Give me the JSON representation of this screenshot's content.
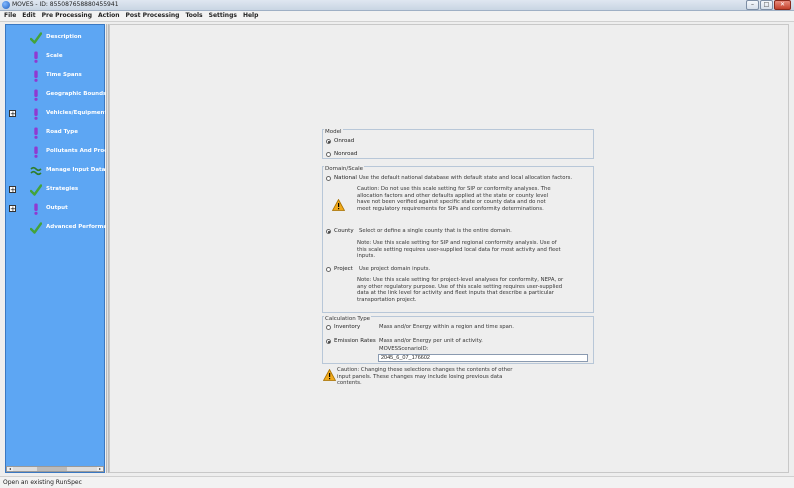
{
  "window": {
    "title": "MOVES - ID: 855087658880455941"
  },
  "menu": [
    "File",
    "Edit",
    "Pre Processing",
    "Action",
    "Post Processing",
    "Tools",
    "Settings",
    "Help"
  ],
  "sidebar": {
    "items": [
      {
        "label": "Description",
        "icon": "check-icon",
        "expander": ""
      },
      {
        "label": "Scale",
        "icon": "exclamation-icon",
        "expander": ""
      },
      {
        "label": "Time Spans",
        "icon": "exclamation-icon",
        "expander": ""
      },
      {
        "label": "Geographic Bounds",
        "icon": "exclamation-icon",
        "expander": ""
      },
      {
        "label": "Vehicles/Equipment",
        "icon": "exclamation-icon",
        "expander": "+"
      },
      {
        "label": "Road Type",
        "icon": "exclamation-icon",
        "expander": ""
      },
      {
        "label": "Pollutants And Processes",
        "icon": "exclamation-icon",
        "expander": ""
      },
      {
        "label": "Manage Input Data Sets",
        "icon": "wave-icon",
        "expander": ""
      },
      {
        "label": "Strategies",
        "icon": "check-icon",
        "expander": "+"
      },
      {
        "label": "Output",
        "icon": "exclamation-icon",
        "expander": "+"
      },
      {
        "label": "Advanced Performance Features",
        "icon": "check-icon",
        "expander": ""
      }
    ],
    "scroll_left": "◂",
    "scroll_right": "▸"
  },
  "model": {
    "title": "Model",
    "options": [
      {
        "label": "Onroad",
        "selected": true
      },
      {
        "label": "Nonroad",
        "selected": false
      }
    ]
  },
  "domain": {
    "title": "Domain/Scale",
    "national_label": "National",
    "national_desc": "Use the default national database with default state and local allocation factors.",
    "national_caution": "Caution: Do not use this scale setting for SIP or conformity analyses. The allocation factors and other defaults applied at the state or county level have not been verified against specific state or county data and do not meet regulatory requirements for SIPs and conformity determinations.",
    "county_label": "County",
    "county_desc": "Select or define a single county that is the entire domain.",
    "county_note": "Note: Use this scale setting for SIP and regional conformity analysis. Use of this scale setting requires user-supplied local data for most activity and fleet inputs.",
    "project_label": "Project",
    "project_desc": "Use project domain inputs.",
    "project_note": "Note: Use this scale setting for project-level analyses for conformity, NEPA, or any other regulatory purpose. Use of this scale setting requires user-supplied data at the link level for activity and fleet inputs that describe a particular transportation project.",
    "selected": "County"
  },
  "calc": {
    "title": "Calculation Type",
    "inventory_label": "Inventory",
    "inventory_desc": "Mass and/or Energy within a region and time span.",
    "rates_label": "Emission Rates",
    "rates_desc": "Mass and/or Energy per unit of activity.",
    "scenario_label": "MOVESScenarioID:",
    "scenario_value": "2045_6_07_176602",
    "selected": "Emission Rates"
  },
  "caution_bottom": "Caution: Changing these selections changes the contents of other input panels. These changes may include losing previous data contents.",
  "status": "Open an existing RunSpec",
  "colors": {
    "sidebar_bg": "#5da6f3",
    "check": "#43a33a",
    "exclamation": "#8f3ad1",
    "warning": "#f0a91b"
  }
}
